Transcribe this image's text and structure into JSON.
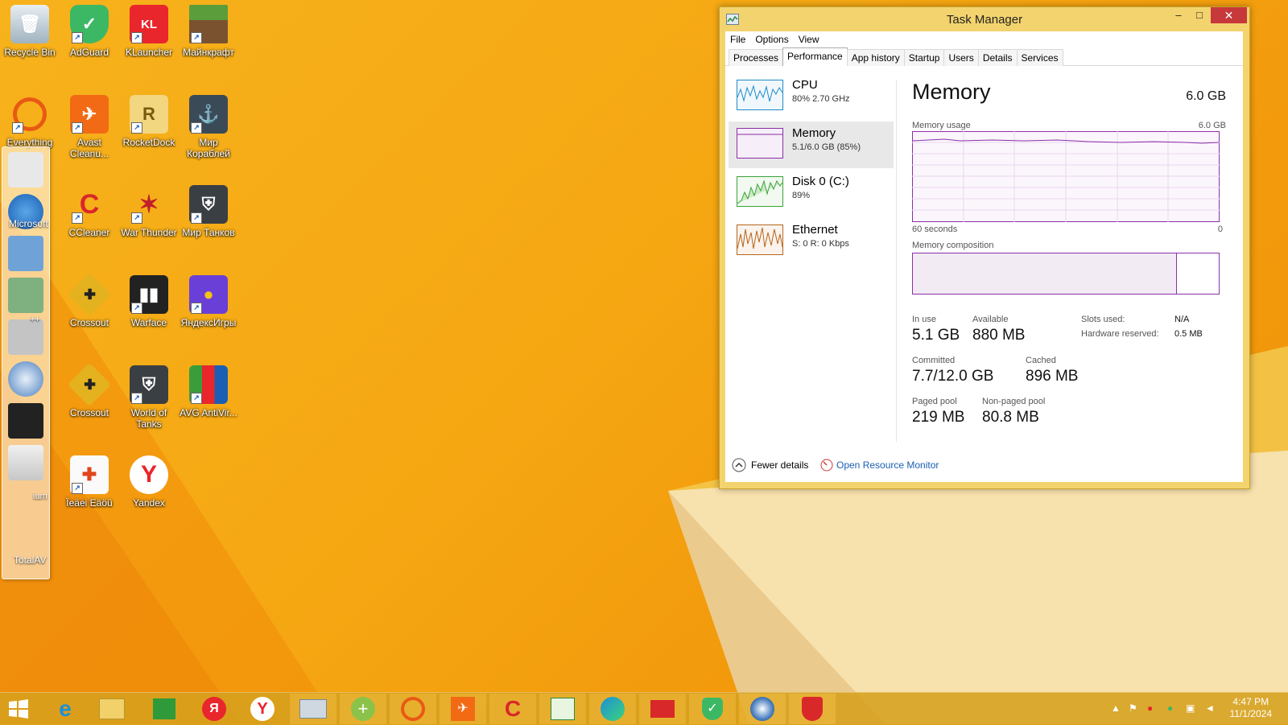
{
  "desktop": {
    "icons": [
      {
        "label": "Recycle Bin",
        "icon": "recycle-bin-icon"
      },
      {
        "label": "AdGuard",
        "icon": "adguard-icon"
      },
      {
        "label": "KLauncher",
        "icon": "klauncher-icon"
      },
      {
        "label": "Майнкрафт",
        "icon": "minecraft-icon"
      },
      {
        "label": "Everything",
        "icon": "everything-icon"
      },
      {
        "label": "Avast Cleanu...",
        "icon": "avast-cleanup-icon"
      },
      {
        "label": "RocketDock",
        "icon": "rocketdock-icon"
      },
      {
        "label": "Мир Кораблей",
        "icon": "world-of-warships-icon"
      },
      {
        "label": "Microsoft",
        "icon": "microsoft-icon"
      },
      {
        "label": "CCleaner",
        "icon": "ccleaner-icon"
      },
      {
        "label": "War Thunder",
        "icon": "war-thunder-icon"
      },
      {
        "label": "Мир Танков",
        "icon": "mir-tankov-icon"
      },
      {
        "label": "Crossout",
        "icon": "crossout-icon"
      },
      {
        "label": "Warface",
        "icon": "warface-icon"
      },
      {
        "label": "ЯндексИгры",
        "icon": "yandex-games-icon"
      },
      {
        "label": "Crossout",
        "icon": "crossout-icon"
      },
      {
        "label": "World of Tanks",
        "icon": "world-of-tanks-icon"
      },
      {
        "label": "AVG AntiVir...",
        "icon": "avg-antivirus-icon"
      },
      {
        "label": "Ïeäеі Eäöü",
        "icon": "gamepad-icon"
      },
      {
        "label": "Yandex",
        "icon": "yandex-browser-icon"
      },
      {
        "label": "TotalAV",
        "icon": "totalav-icon"
      }
    ],
    "dock_partial_labels": [
      "++",
      "ium"
    ]
  },
  "task_manager": {
    "title": "Task Manager",
    "window_buttons": {
      "minimize": "–",
      "maximize": "□",
      "close": "✕"
    },
    "menu": [
      "File",
      "Options",
      "View"
    ],
    "tabs": [
      "Processes",
      "Performance",
      "App history",
      "Startup",
      "Users",
      "Details",
      "Services"
    ],
    "active_tab": "Performance",
    "sidebar": [
      {
        "title": "CPU",
        "sub": "80% 2.70 GHz"
      },
      {
        "title": "Memory",
        "sub": "5.1/6.0 GB (85%)"
      },
      {
        "title": "Disk 0 (C:)",
        "sub": "89%"
      },
      {
        "title": "Ethernet",
        "sub": "S: 0 R: 0 Kbps"
      }
    ],
    "memory": {
      "heading": "Memory",
      "total": "6.0 GB",
      "usage_label": "Memory usage",
      "usage_max": "6.0 GB",
      "graph_left": "60 seconds",
      "graph_right": "0",
      "composition_label": "Memory composition",
      "composition_in_use_fraction": 0.86,
      "stats": {
        "in_use_label": "In use",
        "in_use": "5.1 GB",
        "available_label": "Available",
        "available": "880 MB",
        "slots_label": "Slots used:",
        "slots": "N/A",
        "hw_reserved_label": "Hardware reserved:",
        "hw_reserved": "0.5 MB",
        "committed_label": "Committed",
        "committed": "7.7/12.0 GB",
        "cached_label": "Cached",
        "cached": "896 MB",
        "paged_label": "Paged pool",
        "paged": "219 MB",
        "nonpaged_label": "Non-paged pool",
        "nonpaged": "80.8 MB"
      }
    },
    "footer": {
      "fewer": "Fewer details",
      "resource_monitor": "Open Resource Monitor"
    }
  },
  "taskbar": {
    "apps": [
      "start-icon",
      "internet-explorer-icon",
      "file-explorer-icon",
      "store-icon",
      "yandex-icon",
      "yandex-browser-icon",
      "rocketdock-icon",
      "gamepad-plus-icon",
      "everything-icon",
      "avast-icon",
      "ccleaner-icon",
      "task-manager-icon",
      "edge-icon",
      "toolbox-icon",
      "adguard-icon",
      "browser-icon",
      "shield-icon"
    ],
    "clock_time": "4:47 PM",
    "clock_date": "11/1/2024"
  },
  "colors": {
    "wallpaper": "#f5a712",
    "tm_frame": "#f3d36d",
    "memory_graph": "#8b2fa8",
    "cpu_graph": "#1b8ac7",
    "disk_graph": "#3aa33a",
    "ethernet_graph": "#b5651d",
    "close_button": "#c7383b"
  }
}
